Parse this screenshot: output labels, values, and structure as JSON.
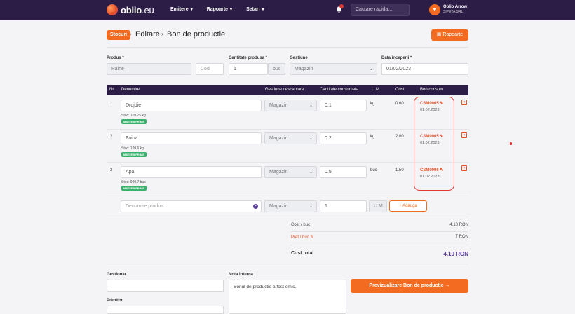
{
  "nav": {
    "brand": "oblio",
    "brand_suffix": ".eu",
    "menu": [
      {
        "label": "Emitere"
      },
      {
        "label": "Rapoarte"
      },
      {
        "label": "Setari"
      }
    ],
    "search_placeholder": "Cautare rapida...",
    "user_initial": "♥",
    "user_name": "Oblio Arrow",
    "user_company": "SIPETA SRL"
  },
  "header": {
    "badge": "Stocuri",
    "crumbs": [
      "Editare",
      "Bon de productie"
    ],
    "rapoarte_button": "Rapoarte"
  },
  "form": {
    "produs_label": "Produs *",
    "produs_value": "Paine",
    "cod_placeholder": "Cod",
    "cantitate_label": "Cantitate produsa *",
    "cantitate_value": "1",
    "cantitate_unit": "buc",
    "gestiune_label": "Gestiune",
    "gestiune_value": "Magazin",
    "data_label": "Data inceperii *",
    "data_value": "01/02/2023"
  },
  "table": {
    "headers": {
      "nr": "Nr.",
      "denumire": "Denumire",
      "gestiune": "Gestiune descarcare",
      "cantitate": "Cantitate consumata",
      "um": "U.M.",
      "cost": "Cost",
      "bon": "Bon consum"
    },
    "rows": [
      {
        "nr": "1",
        "denumire": "Drojdie",
        "stoc": "Stoc: 109.75 kg",
        "tag": "MATERII PRIME",
        "gestiune": "Magazin",
        "cantitate": "0.1",
        "um": "kg",
        "cost": "0.60",
        "bon": "CSM0005",
        "data": "01.02.2023"
      },
      {
        "nr": "2",
        "denumire": "Faina",
        "stoc": "Stoc: 199.6 kg",
        "tag": "MATERII PRIME",
        "gestiune": "Magazin",
        "cantitate": "0.2",
        "um": "kg",
        "cost": "2.00",
        "bon": "CSM0005",
        "data": "01.02.2023"
      },
      {
        "nr": "3",
        "denumire": "Apa",
        "stoc": "Stoc: 999.7 buc",
        "tag": "MATERII PRIME",
        "gestiune": "Magazin",
        "cantitate": "0.5",
        "um": "buc",
        "cost": "1.50",
        "bon": "CSM0006",
        "data": "01.02.2023"
      }
    ],
    "new_row": {
      "denumire_placeholder": "Denumire produs...",
      "gestiune": "Magazin",
      "cantitate": "1",
      "um_placeholder": "U.M.",
      "add_button": "+ Adauga"
    }
  },
  "totals": {
    "cost_label": "Cost / buc",
    "cost_value": "4.10 RON",
    "pret_label": "Pret / buc",
    "pret_value": "7 RON",
    "total_label": "Cost total",
    "total_value": "4.10 RON"
  },
  "bottom": {
    "gestionar_label": "Gestionar",
    "nota_label": "Nota interna",
    "nota_value": "Bonul de productie a fost emis.",
    "primitor_label": "Primitor",
    "preview_button": "Previzualizare Bon de productie →"
  },
  "colors": {
    "nav_bg": "#2b1d45",
    "accent": "#f26b21",
    "highlight": "#e53935",
    "tag_green": "#38b26d"
  }
}
